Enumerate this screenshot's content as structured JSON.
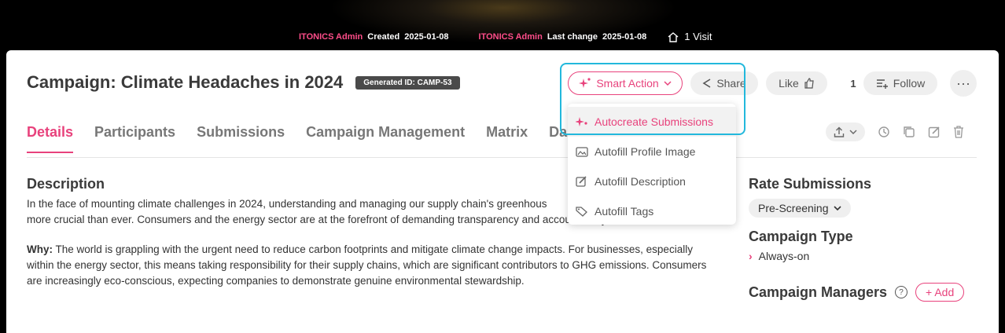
{
  "meta": {
    "creator": "ITONICS Admin",
    "created_label": "Created",
    "created_date": "2025-01-08",
    "changer": "ITONICS Admin",
    "changed_label": "Last change",
    "changed_date": "2025-01-08",
    "visits": "1 Visit"
  },
  "header": {
    "title": "Campaign: Climate Headaches in 2024",
    "generated_id": "Generated ID: CAMP-53"
  },
  "actions": {
    "smart_action": "Smart Action",
    "share": "Share",
    "like": "Like",
    "count": "1",
    "follow": "Follow",
    "more": "···"
  },
  "tabs": [
    "Details",
    "Participants",
    "Submissions",
    "Campaign Management",
    "Matrix",
    "Dash"
  ],
  "smart_menu": [
    {
      "label": "Autocreate Submissions",
      "icon": "sparkle-icon"
    },
    {
      "label": "Autofill Profile Image",
      "icon": "image-icon"
    },
    {
      "label": "Autofill Description",
      "icon": "edit-icon"
    },
    {
      "label": "Autofill Tags",
      "icon": "tag-icon"
    }
  ],
  "content": {
    "description_heading": "Description",
    "para1": "In the face of mounting climate challenges in 2024, understanding and managing our supply chain's greenhous",
    "para1b": "more crucial than ever. Consumers and the energy sector are at the forefront of demanding transparency and accountability.",
    "why_label": "Why:",
    "why_text": "The world is grappling with the urgent need to reduce carbon footprints and mitigate climate change impacts. For businesses, especially within the energy sector, this means taking responsibility for their supply chains, which are significant contributors to GHG emissions. Consumers are increasingly eco-conscious, expecting companies to demonstrate genuine environmental stewardship."
  },
  "side": {
    "rate_heading": "Rate Submissions",
    "rate_value": "Pre-Screening",
    "type_heading": "Campaign Type",
    "type_value": "Always-on",
    "managers_heading": "Campaign Managers",
    "add_label": "Add"
  },
  "colors": {
    "accent": "#e8427c",
    "highlight": "#22b8dc"
  }
}
